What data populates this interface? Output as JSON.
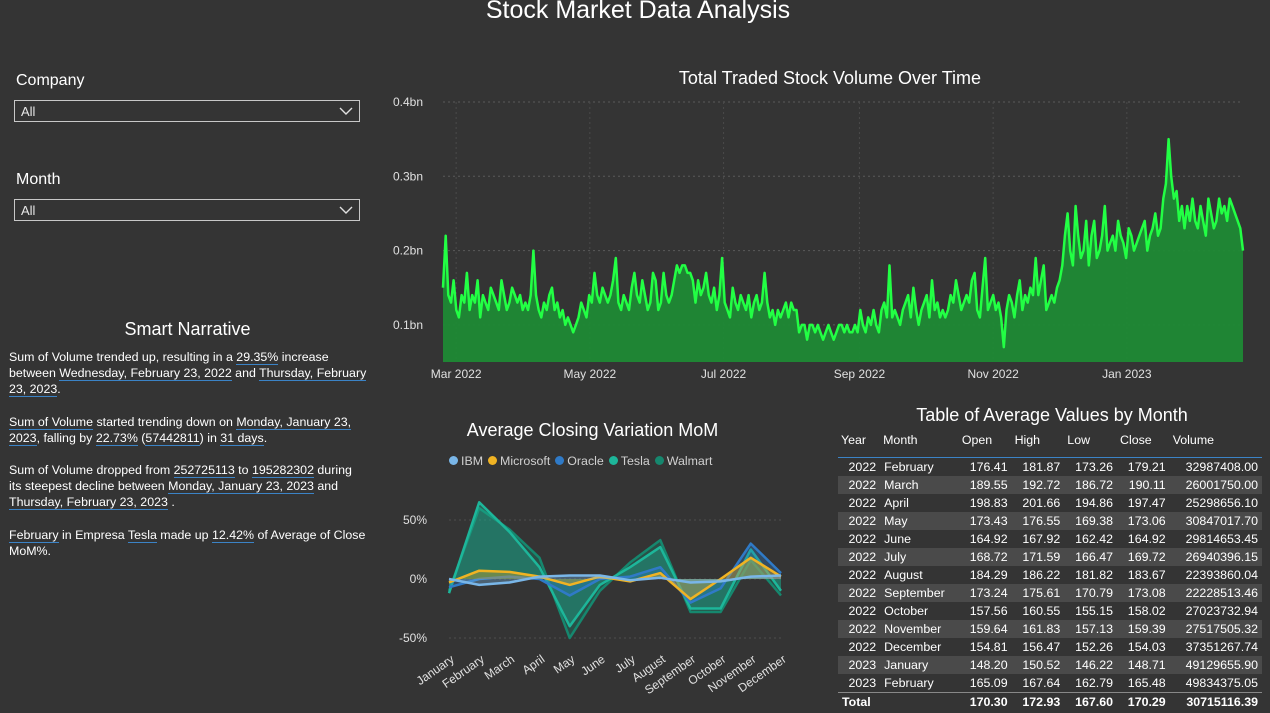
{
  "title": "Stock Market Data Analysis",
  "filters": {
    "company": {
      "label": "Company",
      "value": "All"
    },
    "month": {
      "label": "Month",
      "value": "All"
    }
  },
  "narrative": {
    "title": "Smart Narrative",
    "p1": {
      "t1": "Sum of Volume trended up, resulting in a ",
      "v1": "29.35%",
      "t2": " increase between ",
      "v2": "Wednesday, February 23, 2022",
      "t3": " and ",
      "v3": "Thursday, February 23, 2023",
      "t4": "."
    },
    "p2": {
      "v1": "Sum of Volume",
      "t1": " started trending down on ",
      "v2": "Monday, January 23, 2023",
      "t2": ", falling by ",
      "v3": "22.73%",
      "t3": " (",
      "v4": "57442811",
      "t4": ") in ",
      "v5": "31 days",
      "t5": "."
    },
    "p3": {
      "t1": "Sum of Volume dropped from ",
      "v1": "252725113",
      "t2": " to ",
      "v2": "195282302",
      "t3": " during its steepest decline between ",
      "v3": "Monday, January 23, 2023",
      "t4": " and ",
      "v4": "Thursday, February 23, 2023",
      "t5": " ."
    },
    "p4": {
      "v1": "February",
      "t1": " in Empresa ",
      "v2": "Tesla",
      "t2": " made up ",
      "v3": "12.42%",
      "t3": " of Average of Close MoM%."
    }
  },
  "volume_chart": {
    "title": "Total Traded Stock Volume Over Time",
    "color": "#22ff44",
    "fill": "#1f8a35"
  },
  "mom_chart": {
    "title": "Average Closing Variation MoM",
    "colors": {
      "IBM": "#79b6e8",
      "Microsoft": "#f0b323",
      "Oracle": "#2f7ac7",
      "Tesla": "#1db69a",
      "Walmart": "#16876e"
    }
  },
  "table": {
    "title": "Table of Average Values by Month",
    "columns": [
      "Year",
      "Month",
      "Open",
      "High",
      "Low",
      "Close",
      "Volume"
    ],
    "rows": [
      [
        "2022",
        "February",
        "176.41",
        "181.87",
        "173.26",
        "179.21",
        "32987408.00"
      ],
      [
        "2022",
        "March",
        "189.55",
        "192.72",
        "186.72",
        "190.11",
        "26001750.00"
      ],
      [
        "2022",
        "April",
        "198.83",
        "201.66",
        "194.86",
        "197.47",
        "25298656.10"
      ],
      [
        "2022",
        "May",
        "173.43",
        "176.55",
        "169.38",
        "173.06",
        "30847017.70"
      ],
      [
        "2022",
        "June",
        "164.92",
        "167.92",
        "162.42",
        "164.92",
        "29814653.45"
      ],
      [
        "2022",
        "July",
        "168.72",
        "171.59",
        "166.47",
        "169.72",
        "26940396.15"
      ],
      [
        "2022",
        "August",
        "184.29",
        "186.22",
        "181.82",
        "183.67",
        "22393860.04"
      ],
      [
        "2022",
        "September",
        "173.24",
        "175.61",
        "170.79",
        "173.08",
        "22228513.46"
      ],
      [
        "2022",
        "October",
        "157.56",
        "160.55",
        "155.15",
        "158.02",
        "27023732.94"
      ],
      [
        "2022",
        "November",
        "159.64",
        "161.83",
        "157.13",
        "159.39",
        "27517505.32"
      ],
      [
        "2022",
        "December",
        "154.81",
        "156.47",
        "152.26",
        "154.03",
        "37351267.74"
      ],
      [
        "2023",
        "January",
        "148.20",
        "150.52",
        "146.22",
        "148.71",
        "49129655.90"
      ],
      [
        "2023",
        "February",
        "165.09",
        "167.64",
        "162.79",
        "165.48",
        "49834375.05"
      ]
    ],
    "total": [
      "Total",
      "",
      "170.30",
      "172.93",
      "167.60",
      "170.29",
      "30715116.39"
    ]
  },
  "chart_data": [
    {
      "type": "area",
      "title": "Total Traded Stock Volume Over Time",
      "x_range": [
        "2022-02-23",
        "2023-02-23"
      ],
      "x_ticks": [
        "Mar 2022",
        "May 2022",
        "Jul 2022",
        "Sep 2022",
        "Nov 2022",
        "Jan 2023"
      ],
      "y_ticks": [
        "0.1bn",
        "0.2bn",
        "0.3bn",
        "0.4bn"
      ],
      "ylim": [
        0.05,
        0.4
      ],
      "y_unit": "bn",
      "series": [
        {
          "values": [
            0.15,
            0.22,
            0.14,
            0.13,
            0.16,
            0.12,
            0.11,
            0.14,
            0.13,
            0.17,
            0.12,
            0.14,
            0.13,
            0.16,
            0.11,
            0.14,
            0.13,
            0.12,
            0.15,
            0.14,
            0.13,
            0.12,
            0.16,
            0.14,
            0.12,
            0.13,
            0.15,
            0.14,
            0.13,
            0.14,
            0.12,
            0.13,
            0.12,
            0.14,
            0.2,
            0.14,
            0.12,
            0.11,
            0.13,
            0.12,
            0.14,
            0.15,
            0.12,
            0.13,
            0.11,
            0.12,
            0.1,
            0.11,
            0.1,
            0.09,
            0.1,
            0.11,
            0.13,
            0.12,
            0.11,
            0.14,
            0.13,
            0.17,
            0.14,
            0.13,
            0.15,
            0.14,
            0.13,
            0.14,
            0.16,
            0.19,
            0.13,
            0.12,
            0.14,
            0.13,
            0.12,
            0.15,
            0.17,
            0.14,
            0.13,
            0.16,
            0.14,
            0.12,
            0.13,
            0.17,
            0.16,
            0.12,
            0.13,
            0.17,
            0.14,
            0.13,
            0.14,
            0.16,
            0.18,
            0.17,
            0.18,
            0.18,
            0.17,
            0.17,
            0.16,
            0.13,
            0.16,
            0.14,
            0.15,
            0.17,
            0.14,
            0.13,
            0.15,
            0.12,
            0.14,
            0.19,
            0.13,
            0.12,
            0.11,
            0.15,
            0.13,
            0.12,
            0.14,
            0.13,
            0.12,
            0.14,
            0.11,
            0.13,
            0.14,
            0.12,
            0.13,
            0.17,
            0.13,
            0.11,
            0.12,
            0.1,
            0.12,
            0.11,
            0.12,
            0.13,
            0.11,
            0.13,
            0.12,
            0.12,
            0.09,
            0.1,
            0.1,
            0.08,
            0.1,
            0.1,
            0.09,
            0.1,
            0.09,
            0.08,
            0.09,
            0.1,
            0.09,
            0.08,
            0.09,
            0.1,
            0.1,
            0.09,
            0.1,
            0.09,
            0.09,
            0.1,
            0.09,
            0.12,
            0.1,
            0.09,
            0.11,
            0.1,
            0.12,
            0.1,
            0.09,
            0.12,
            0.13,
            0.11,
            0.18,
            0.11,
            0.12,
            0.11,
            0.1,
            0.12,
            0.13,
            0.14,
            0.11,
            0.15,
            0.12,
            0.1,
            0.12,
            0.13,
            0.14,
            0.11,
            0.16,
            0.12,
            0.13,
            0.11,
            0.12,
            0.11,
            0.12,
            0.14,
            0.13,
            0.16,
            0.14,
            0.12,
            0.13,
            0.14,
            0.13,
            0.16,
            0.17,
            0.12,
            0.11,
            0.15,
            0.19,
            0.12,
            0.13,
            0.14,
            0.12,
            0.13,
            0.11,
            0.07,
            0.12,
            0.14,
            0.13,
            0.11,
            0.14,
            0.16,
            0.12,
            0.14,
            0.13,
            0.15,
            0.14,
            0.19,
            0.14,
            0.16,
            0.18,
            0.12,
            0.13,
            0.14,
            0.13,
            0.15,
            0.16,
            0.18,
            0.22,
            0.25,
            0.2,
            0.18,
            0.26,
            0.22,
            0.19,
            0.2,
            0.24,
            0.18,
            0.22,
            0.24,
            0.19,
            0.2,
            0.22,
            0.26,
            0.2,
            0.21,
            0.22,
            0.2,
            0.24,
            0.22,
            0.21,
            0.19,
            0.23,
            0.22,
            0.2,
            0.21,
            0.22,
            0.23,
            0.24,
            0.2,
            0.22,
            0.23,
            0.25,
            0.22,
            0.23,
            0.27,
            0.29,
            0.35,
            0.3,
            0.27,
            0.28,
            0.24,
            0.26,
            0.23,
            0.26,
            0.24,
            0.27,
            0.24,
            0.23,
            0.26,
            0.24,
            0.22,
            0.27,
            0.25,
            0.23,
            0.24,
            0.27,
            0.25,
            0.26,
            0.24,
            0.27,
            0.26,
            0.25,
            0.24,
            0.23,
            0.2
          ]
        }
      ]
    },
    {
      "type": "area",
      "title": "Average Closing Variation MoM",
      "categories": [
        "January",
        "February",
        "March",
        "April",
        "May",
        "June",
        "July",
        "August",
        "September",
        "October",
        "November",
        "December"
      ],
      "y_ticks": [
        "-50%",
        "0%",
        "50%"
      ],
      "ylim": [
        -50,
        60
      ],
      "legend": "top",
      "series": [
        {
          "name": "IBM",
          "values": [
            0,
            -5,
            -3,
            2,
            3,
            3,
            -1,
            1,
            -3,
            -2,
            2,
            3
          ]
        },
        {
          "name": "Microsoft",
          "values": [
            -3,
            7,
            6,
            2,
            -5,
            2,
            -2,
            5,
            -17,
            0,
            18,
            2
          ]
        },
        {
          "name": "Oracle",
          "values": [
            -7,
            0,
            2,
            0,
            -14,
            0,
            2,
            10,
            -20,
            -8,
            30,
            5
          ]
        },
        {
          "name": "Tesla",
          "values": [
            -12,
            65,
            40,
            10,
            -40,
            -5,
            10,
            27,
            -25,
            -25,
            25,
            -10
          ]
        },
        {
          "name": "Walmart",
          "values": [
            -10,
            60,
            42,
            18,
            -50,
            -10,
            14,
            33,
            -28,
            -28,
            16,
            -14
          ]
        }
      ]
    }
  ]
}
